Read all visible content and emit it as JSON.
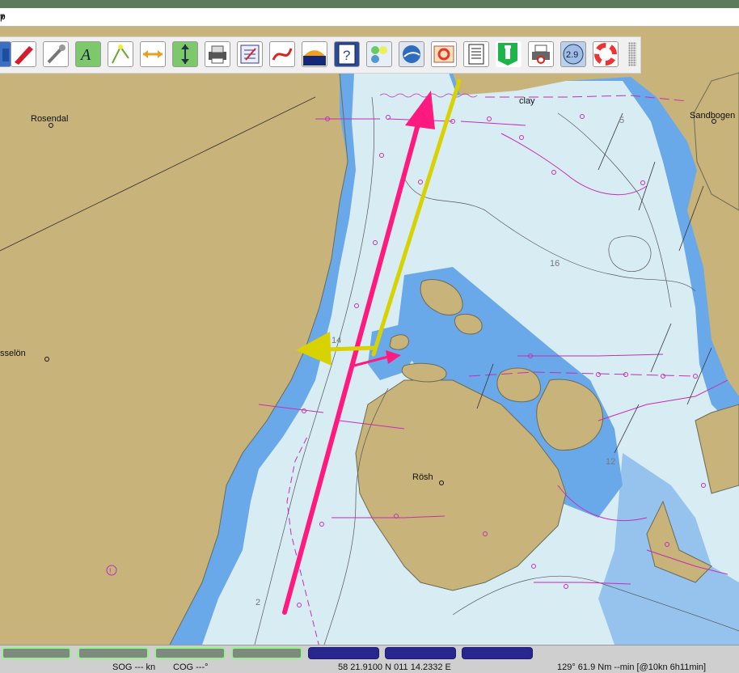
{
  "window": {
    "title": "p",
    "dropdown_icon": "chevron-down-icon"
  },
  "toolbar": {
    "items": [
      {
        "name": "ship-icon",
        "label": "Ship"
      },
      {
        "name": "settings-wrench-icon",
        "label": "Settings"
      },
      {
        "name": "text-annotation-icon",
        "label": "Text"
      },
      {
        "name": "route-icon",
        "label": "Route"
      },
      {
        "name": "measure-horizontal-icon",
        "label": "Measure"
      },
      {
        "name": "measure-vertical-icon",
        "label": "Measure depth"
      },
      {
        "name": "print-icon",
        "label": "Print"
      },
      {
        "name": "route-list-icon",
        "label": "Route manager"
      },
      {
        "name": "track-icon",
        "label": "Track"
      },
      {
        "name": "tide-icon",
        "label": "Tides"
      },
      {
        "name": "help-icon",
        "label": "Help"
      },
      {
        "name": "layers-icon",
        "label": "Layers"
      },
      {
        "name": "globe-icon",
        "label": "Google Earth"
      },
      {
        "name": "lifesaver-scroll-icon",
        "label": "MOB"
      },
      {
        "name": "document-icon",
        "label": "Log"
      },
      {
        "name": "lighthouse-icon",
        "label": "Lights"
      },
      {
        "name": "print-preview-icon",
        "label": "Print preview"
      },
      {
        "name": "zoom-scale-icon",
        "label": "2.9"
      },
      {
        "name": "lifebuoy-icon",
        "label": "Man overboard"
      }
    ]
  },
  "map": {
    "places": [
      "Rosendal",
      "sselön",
      "Rösh",
      "Sandbogen",
      "clay"
    ],
    "depths": [
      "5",
      "16",
      "14",
      "12",
      "2"
    ]
  },
  "status": {
    "sog": "SOG --- kn",
    "cog": "COG ---°",
    "position": "58 21.9100 N   011 14.2332 E",
    "bearing": "129°   61.9 Nm  --min [@10kn 6h11min]"
  },
  "colors": {
    "land": "#c8b37a",
    "shallow": "#6aa9e9",
    "deep": "#d8ecf4",
    "route": "#ff1a80",
    "annotation": "#d8d200"
  }
}
